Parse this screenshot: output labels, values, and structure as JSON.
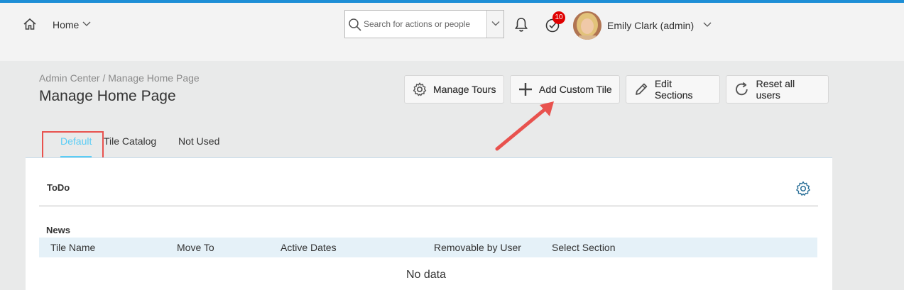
{
  "header": {
    "home_label": "Home",
    "search_placeholder": "Search for actions or people",
    "todo_badge": "10",
    "user_name": "Emily Clark (admin)"
  },
  "page": {
    "breadcrumb": "Admin Center / Manage Home Page",
    "title": "Manage Home Page"
  },
  "actions": {
    "manage_tours": "Manage Tours",
    "add_custom_tile": "Add Custom Tile",
    "edit_sections": "Edit Sections",
    "reset_all_users": "Reset all users"
  },
  "tabs": [
    {
      "label": "Default",
      "active": true
    },
    {
      "label": "Tile Catalog"
    },
    {
      "label": "Not Used"
    }
  ],
  "sections": {
    "todo_title": "ToDo",
    "news_title": "News",
    "columns": [
      "Tile Name",
      "Move To",
      "Active Dates",
      "Removable by User",
      "Select Section"
    ],
    "empty_text": "No data"
  },
  "colors": {
    "accent": "#1d8ed6",
    "tab_active": "#5bcdf5",
    "highlight": "#e8524e",
    "badge": "#e00000"
  }
}
